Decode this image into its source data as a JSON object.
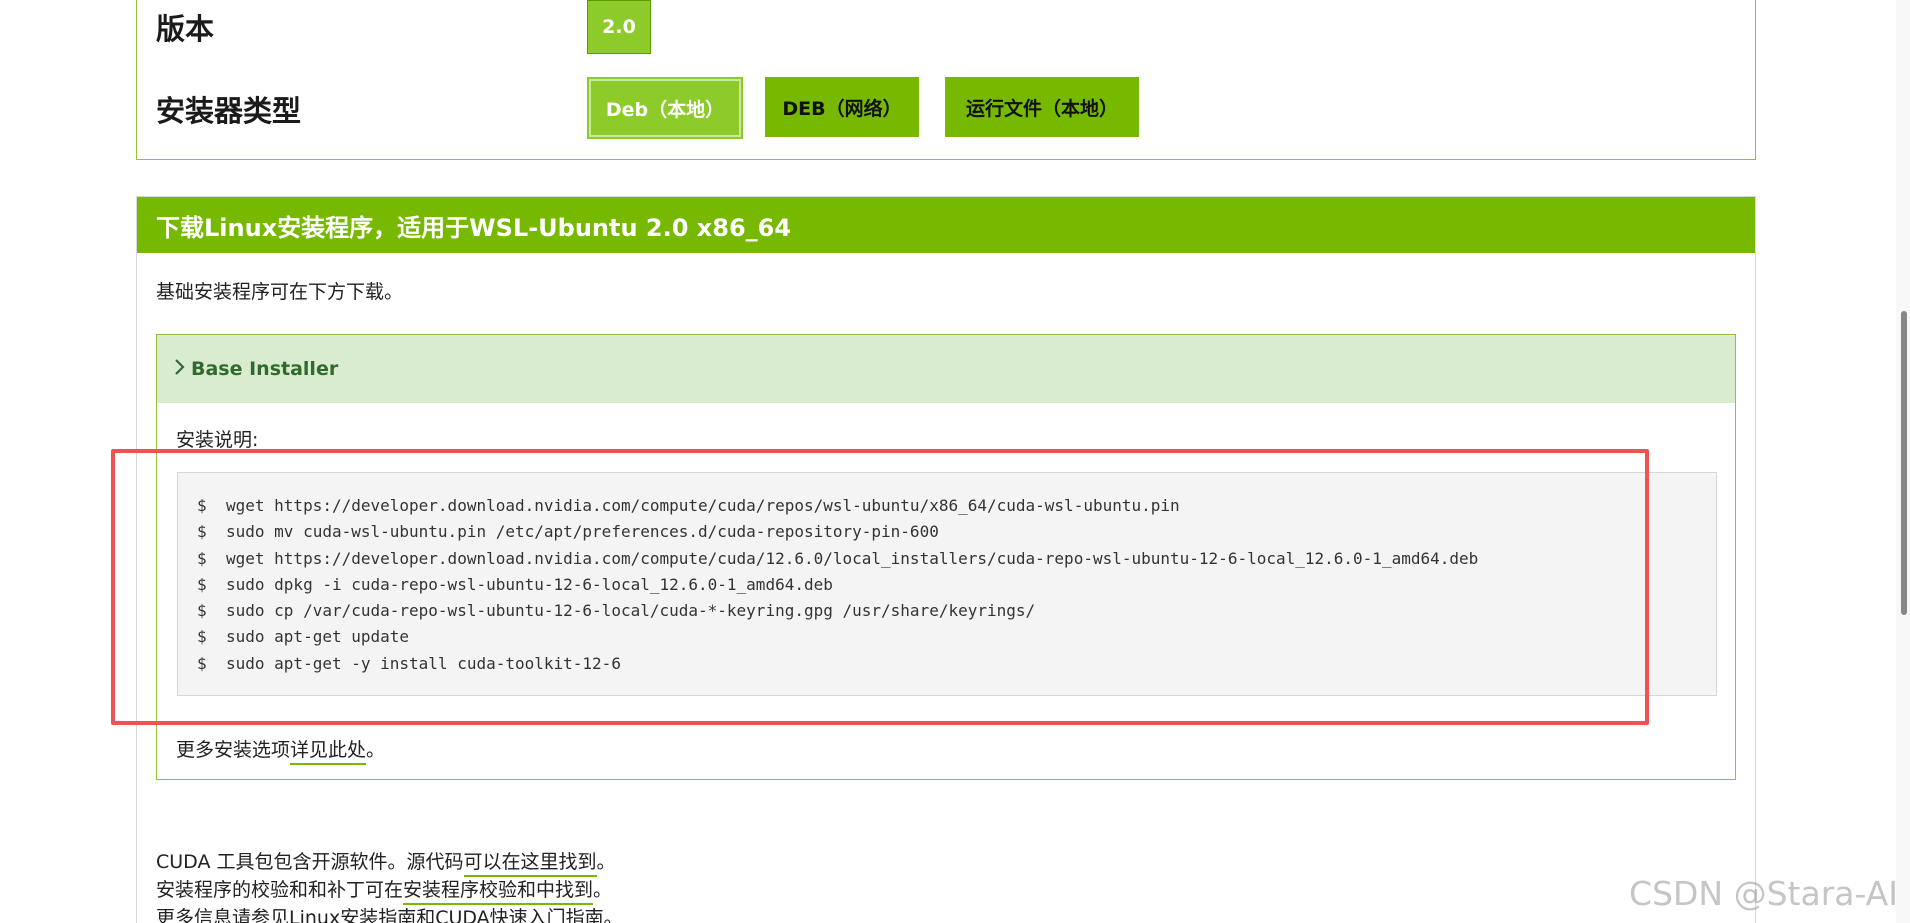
{
  "version_row": {
    "label": "版本",
    "value": "2.0"
  },
  "installer_type_row": {
    "label": "安装器类型",
    "options": [
      {
        "label": "Deb（本地）",
        "selected": true
      },
      {
        "label": "DEB（网络）",
        "selected": false
      },
      {
        "label": "运行文件（本地）",
        "selected": false
      }
    ]
  },
  "download": {
    "title": "下载Linux安装程序，适用于WSL-Ubuntu 2.0 x86_64",
    "description": "基础安装程序可在下方下载。",
    "installer": {
      "title": "Base Installer",
      "instructions_label": "安装说明:",
      "prompt": "$",
      "commands": [
        "wget https://developer.download.nvidia.com/compute/cuda/repos/wsl-ubuntu/x86_64/cuda-wsl-ubuntu.pin",
        "sudo mv cuda-wsl-ubuntu.pin /etc/apt/preferences.d/cuda-repository-pin-600",
        "wget https://developer.download.nvidia.com/compute/cuda/12.6.0/local_installers/cuda-repo-wsl-ubuntu-12-6-local_12.6.0-1_amd64.deb",
        "sudo dpkg -i cuda-repo-wsl-ubuntu-12-6-local_12.6.0-1_amd64.deb",
        "sudo cp /var/cuda-repo-wsl-ubuntu-12-6-local/cuda-*-keyring.gpg /usr/share/keyrings/",
        "sudo apt-get update",
        "sudo apt-get -y install cuda-toolkit-12-6"
      ],
      "more_prefix": "更多安装选项",
      "more_link": "详见此处",
      "more_suffix": "。"
    },
    "notes": [
      {
        "prefix": "CUDA 工具包包含开源软件。源代码",
        "link": "可以在这里找到",
        "suffix": "。"
      },
      {
        "prefix": "安装程序的校验和和补丁可在",
        "link": "安装程序校验和中找到",
        "suffix": "。"
      },
      {
        "prefix": "更多信息请参见Linux安装指南和CUDA快速入门指南",
        "link": "",
        "suffix": "。"
      }
    ]
  },
  "watermark": "CSDN @Stara-AI",
  "colors": {
    "nvidia_green": "#76b900",
    "selected_green": "#8ccb2a",
    "highlight_red": "#ef5350",
    "accordion_bg": "#d9ecd0"
  }
}
